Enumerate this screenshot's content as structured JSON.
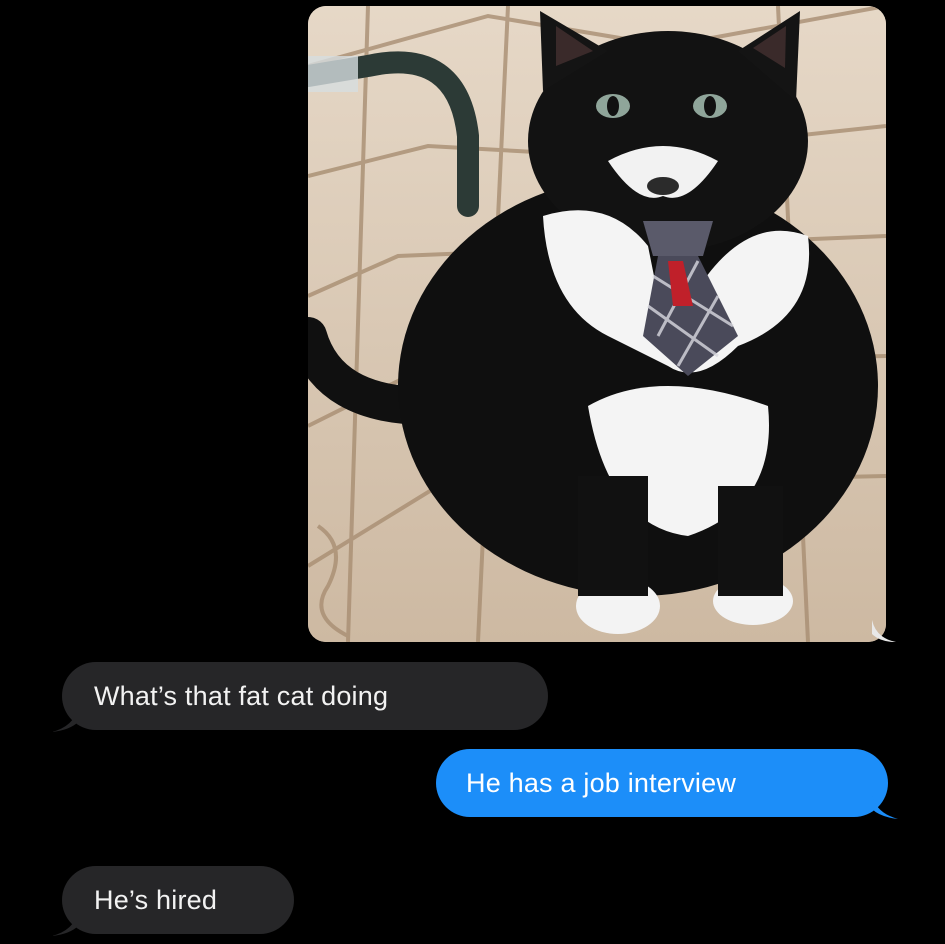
{
  "conversation": {
    "messages": [
      {
        "sender": "me",
        "type": "image",
        "image_subject": "black-and-white cat wearing a plaid necktie"
      },
      {
        "sender": "them",
        "type": "text",
        "text": "What’s that fat cat doing"
      },
      {
        "sender": "me",
        "type": "text",
        "text": "He has a job interview"
      },
      {
        "sender": "them",
        "type": "text",
        "text": "He’s hired"
      }
    ]
  },
  "colors": {
    "background": "#000000",
    "received_bubble": "#262628",
    "sent_bubble": "#1c8ef9",
    "received_text": "#f2f2f2",
    "sent_text": "#ffffff"
  }
}
